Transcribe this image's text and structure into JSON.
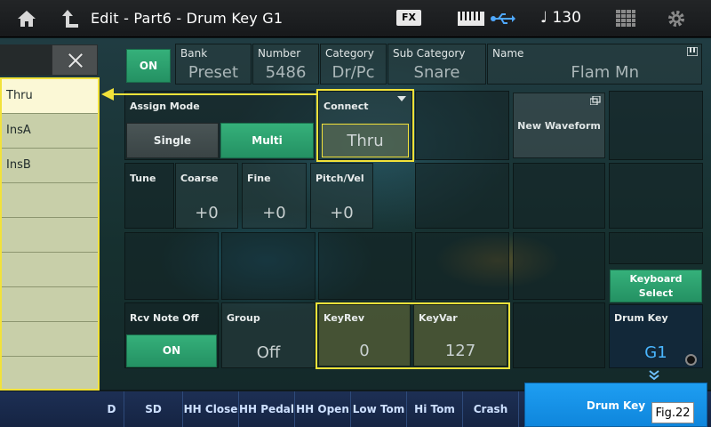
{
  "header": {
    "title": "Edit - Part6 - Drum Key G1",
    "fx_badge": "FX",
    "tempo_value": "130"
  },
  "part_header": {
    "on_label": "ON",
    "bank": {
      "label": "Bank",
      "value": "Preset"
    },
    "number": {
      "label": "Number",
      "value": "5486"
    },
    "category": {
      "label": "Category",
      "value": "Dr/Pc"
    },
    "sub_category": {
      "label": "Sub Category",
      "value": "Snare"
    },
    "name": {
      "label": "Name",
      "value": "Flam Mn"
    }
  },
  "assign_mode": {
    "label": "Assign Mode",
    "options": [
      "Single",
      "Multi"
    ],
    "selected": "Multi"
  },
  "connect": {
    "label": "Connect",
    "value": "Thru"
  },
  "new_waveform_label": "New Waveform",
  "tune": {
    "label": "Tune",
    "coarse": {
      "label": "Coarse",
      "value": "+0"
    },
    "fine": {
      "label": "Fine",
      "value": "+0"
    },
    "pitch_vel": {
      "label": "Pitch/Vel",
      "value": "+0"
    }
  },
  "rcv_note_off": {
    "label": "Rcv Note Off",
    "value": "ON"
  },
  "group": {
    "label": "Group",
    "value": "Off"
  },
  "key_rev": {
    "label": "KeyRev",
    "value": "0"
  },
  "key_var": {
    "label": "KeyVar",
    "value": "127"
  },
  "keyboard_select_label": "Keyboard Select",
  "drum_key": {
    "label": "Drum Key",
    "value": "G1"
  },
  "dropdown": {
    "items": [
      "Thru",
      "InsA",
      "InsB",
      "",
      "",
      "",
      "",
      "",
      ""
    ],
    "selected_index": 0
  },
  "bottom_tabs": [
    "D",
    "SD",
    "HH Close",
    "HH Pedal",
    "HH Open",
    "Low Tom",
    "Hi Tom",
    "Crash"
  ],
  "active_tab": "Drum Key",
  "figure_label": "Fig.22",
  "colors": {
    "highlight": "#f2e23a",
    "accent_green": "#2ea36f",
    "accent_blue": "#1596e8"
  }
}
